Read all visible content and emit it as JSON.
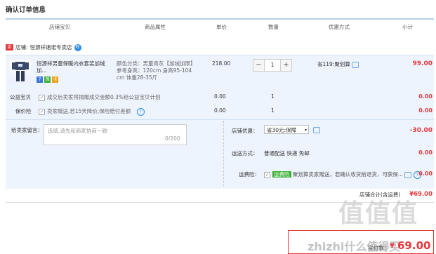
{
  "page": {
    "title": "确认订单信息"
  },
  "columns": [
    "店铺宝贝",
    "商品属性",
    "单价",
    "数量",
    "优惠方式",
    "小计"
  ],
  "shop": {
    "label": "店铺:",
    "name": "恒源祥诸诺专卖店"
  },
  "item": {
    "name_line1": "恒源祥男童保暖内衣套装加绒加...",
    "attr_color": "颜色分类：男童青灰【加绒加厚】",
    "attr_height": "参考身高：120cm 身高95-104",
    "attr_weight": "cm 体重28-35斤",
    "price": "218.00",
    "qty": "1",
    "qty_minus": "−",
    "qty_plus": "+",
    "promo": "省119:聚划算",
    "subtotal": "99.00"
  },
  "charity": {
    "label": "公益宝贝",
    "text": "成交后卖家将捐赠成交金额0.3%给公益宝贝计划",
    "price": "0.00",
    "qty": "1",
    "subtotal": "0.00"
  },
  "price_protect": {
    "label": "保价险",
    "text": "卖家赠送,若15天降价,保险赔付差额",
    "price": "0.00",
    "qty": "1",
    "subtotal": "0.00"
  },
  "message": {
    "label": "给卖家留言：",
    "placeholder": "选填,请先和商家协商一致",
    "counter": "0/200"
  },
  "shop_discount": {
    "label": "店铺优惠：",
    "selected": "省30元:保障",
    "value": "-30.00"
  },
  "shipping": {
    "label": "运送方式：",
    "value": "普通配送 快递 免邮",
    "price": "0.00"
  },
  "freight_insurance": {
    "label": "运费险：",
    "tag": "运费险",
    "text": "聚划算卖家赠送，若确认收货前退货，可获保...",
    "price": "0.00"
  },
  "shop_total": {
    "label": "店铺合计(含运费)",
    "value": "¥69.00"
  },
  "payment": {
    "label": "实付款：",
    "currency": "¥",
    "value": "69.00"
  },
  "watermark": {
    "text": "值值值",
    "site": "zhizhi什么值得买"
  },
  "colors": {
    "accent": "#e4393c",
    "blue": "#2b8be6",
    "panel": "#eef4fd"
  }
}
